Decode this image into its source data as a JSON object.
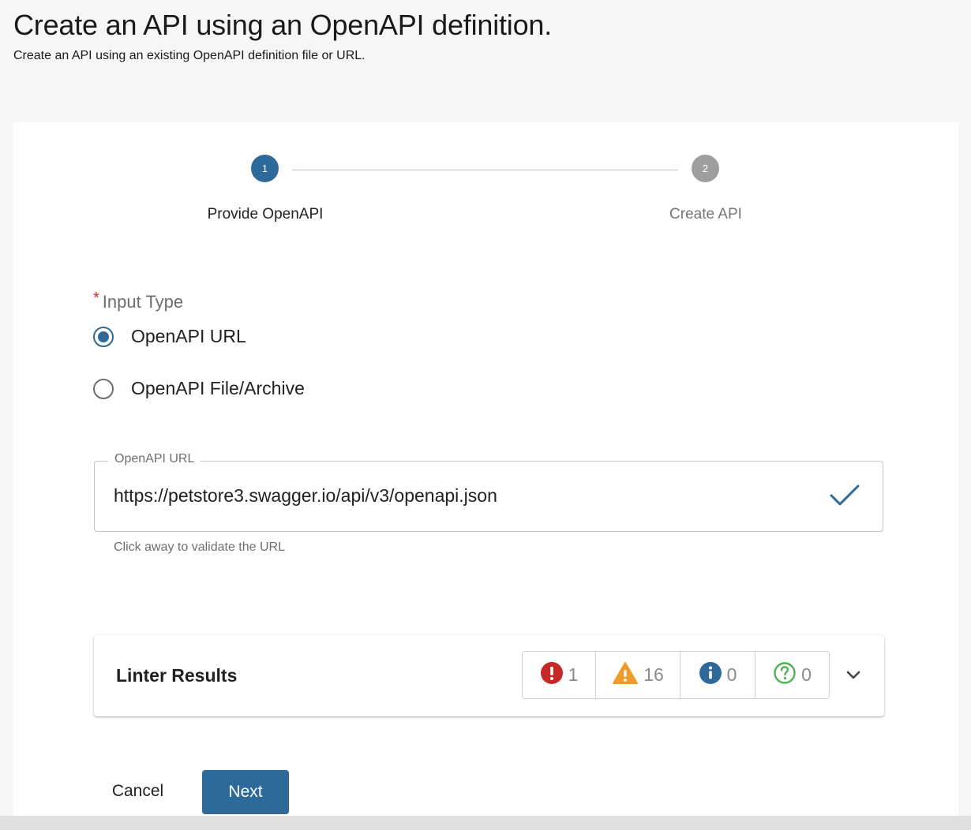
{
  "header": {
    "title": "Create an API using an OpenAPI definition.",
    "subtitle": "Create an API using an existing OpenAPI definition file or URL."
  },
  "stepper": {
    "steps": [
      {
        "number": "1",
        "label": "Provide OpenAPI",
        "state": "active"
      },
      {
        "number": "2",
        "label": "Create API",
        "state": "inactive"
      }
    ]
  },
  "input_type": {
    "required_marker": "*",
    "label": "Input Type",
    "options": [
      {
        "label": "OpenAPI URL",
        "selected": true
      },
      {
        "label": "OpenAPI File/Archive",
        "selected": false
      }
    ]
  },
  "url_field": {
    "label": "OpenAPI URL",
    "value": "https://petstore3.swagger.io/api/v3/openapi.json",
    "helper_text": "Click away to validate the URL",
    "status_icon": "check-icon"
  },
  "linter": {
    "title": "Linter Results",
    "counts": {
      "error": "1",
      "warning": "16",
      "info": "0",
      "hint": "0"
    },
    "colors": {
      "error": "#c62828",
      "warning": "#ef9a2f",
      "info": "#2d6a99",
      "hint": "#4caf50"
    }
  },
  "actions": {
    "cancel_label": "Cancel",
    "next_label": "Next"
  },
  "theme": {
    "primary": "#2d6a99",
    "inactive": "#9e9e9e"
  }
}
